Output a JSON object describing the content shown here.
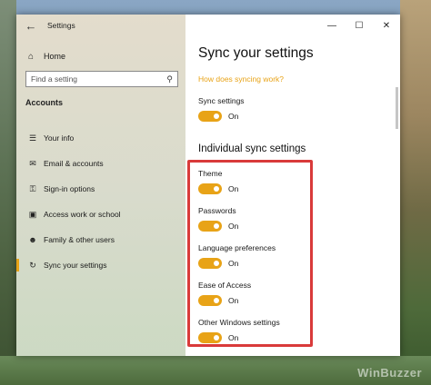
{
  "window": {
    "title": "Settings",
    "controls": [
      "minimize",
      "maximize",
      "close"
    ]
  },
  "sidebar": {
    "home_label": "Home",
    "search_placeholder": "Find a setting",
    "section_label": "Accounts",
    "items": [
      {
        "label": "Your info",
        "icon": "person-card-icon"
      },
      {
        "label": "Email & accounts",
        "icon": "mail-icon"
      },
      {
        "label": "Sign-in options",
        "icon": "key-icon"
      },
      {
        "label": "Access work or school",
        "icon": "briefcase-icon"
      },
      {
        "label": "Family & other users",
        "icon": "people-icon"
      },
      {
        "label": "Sync your settings",
        "icon": "sync-icon",
        "active": true
      }
    ]
  },
  "main": {
    "title": "Sync your settings",
    "help_link": "How does syncing work?",
    "sync_settings": {
      "label": "Sync settings",
      "state": "On"
    },
    "individual_heading": "Individual sync settings",
    "individual": [
      {
        "label": "Theme",
        "state": "On"
      },
      {
        "label": "Passwords",
        "state": "On"
      },
      {
        "label": "Language preferences",
        "state": "On"
      },
      {
        "label": "Ease of Access",
        "state": "On"
      },
      {
        "label": "Other Windows settings",
        "state": "On"
      }
    ]
  },
  "colors": {
    "accent": "#e8a317",
    "highlight_border": "#d93a3a"
  },
  "watermark": "WinBuzzer"
}
